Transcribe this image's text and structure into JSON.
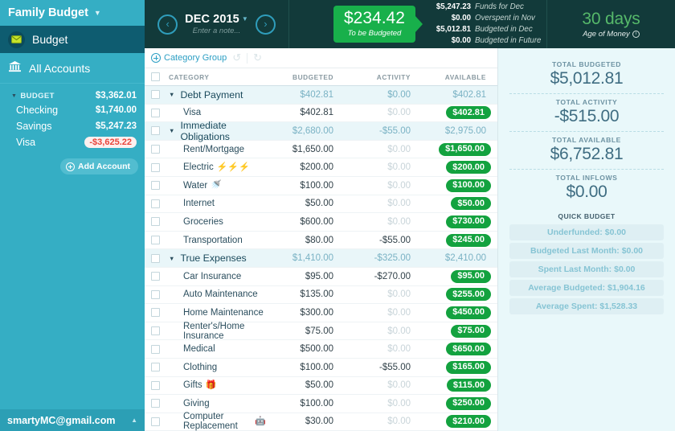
{
  "sidebar": {
    "budget_name": "Family Budget",
    "budget_nav_label": "Budget",
    "accounts_nav_label": "All Accounts",
    "group_label": "BUDGET",
    "group_total": "$3,362.01",
    "accounts": [
      {
        "name": "Checking",
        "balance": "$1,740.00",
        "negative": false
      },
      {
        "name": "Savings",
        "balance": "$5,247.23",
        "negative": false
      },
      {
        "name": "Visa",
        "balance": "-$3,625.22",
        "negative": true
      }
    ],
    "add_account_label": "Add Account",
    "user_email": "smartyMC@gmail.com"
  },
  "header": {
    "month": "DEC 2015",
    "note_placeholder": "Enter a note...",
    "prev_label": "‹",
    "next_label": "›",
    "to_be_budgeted_amount": "$234.42",
    "to_be_budgeted_label": "To be Budgeted",
    "breakdown": [
      {
        "amount": "$5,247.23",
        "label": "Funds for Dec"
      },
      {
        "amount": "$0.00",
        "label": "Overspent in Nov"
      },
      {
        "amount": "$5,012.81",
        "label": "Budgeted in Dec"
      },
      {
        "amount": "$0.00",
        "label": "Budgeted in Future"
      }
    ],
    "age_of_money_value": "30 days",
    "age_of_money_label": "Age of Money"
  },
  "toolbar": {
    "category_group_label": "Category Group",
    "undo_icon": "undo-icon",
    "redo_icon": "redo-icon"
  },
  "table": {
    "columns": {
      "category": "CATEGORY",
      "budgeted": "BUDGETED",
      "activity": "ACTIVITY",
      "available": "AVAILABLE"
    },
    "rows": [
      {
        "type": "group",
        "name": "Debt Payment",
        "budgeted": "$402.81",
        "activity": "$0.00",
        "available": "$402.81",
        "emoji": ""
      },
      {
        "type": "item",
        "name": "Visa",
        "budgeted": "$402.81",
        "activity": "$0.00",
        "activity_zero": true,
        "available": "$402.81",
        "emoji": ""
      },
      {
        "type": "group",
        "name": "Immediate Obligations",
        "budgeted": "$2,680.00",
        "activity": "-$55.00",
        "available": "$2,975.00",
        "emoji": ""
      },
      {
        "type": "item",
        "name": "Rent/Mortgage",
        "budgeted": "$1,650.00",
        "activity": "$0.00",
        "activity_zero": true,
        "available": "$1,650.00",
        "emoji": ""
      },
      {
        "type": "item",
        "name": "Electric",
        "budgeted": "$200.00",
        "activity": "$0.00",
        "activity_zero": true,
        "available": "$200.00",
        "emoji": "⚡⚡⚡"
      },
      {
        "type": "item",
        "name": "Water",
        "budgeted": "$100.00",
        "activity": "$0.00",
        "activity_zero": true,
        "available": "$100.00",
        "emoji": "🚿"
      },
      {
        "type": "item",
        "name": "Internet",
        "budgeted": "$50.00",
        "activity": "$0.00",
        "activity_zero": true,
        "available": "$50.00",
        "emoji": ""
      },
      {
        "type": "item",
        "name": "Groceries",
        "budgeted": "$600.00",
        "activity": "$0.00",
        "activity_zero": true,
        "available": "$730.00",
        "emoji": ""
      },
      {
        "type": "item",
        "name": "Transportation",
        "budgeted": "$80.00",
        "activity": "-$55.00",
        "available": "$245.00",
        "emoji": ""
      },
      {
        "type": "group",
        "name": "True Expenses",
        "budgeted": "$1,410.00",
        "activity": "-$325.00",
        "available": "$2,410.00",
        "emoji": ""
      },
      {
        "type": "item",
        "name": "Car Insurance",
        "budgeted": "$95.00",
        "activity": "-$270.00",
        "available": "$95.00",
        "emoji": ""
      },
      {
        "type": "item",
        "name": "Auto Maintenance",
        "budgeted": "$135.00",
        "activity": "$0.00",
        "activity_zero": true,
        "available": "$255.00",
        "emoji": ""
      },
      {
        "type": "item",
        "name": "Home Maintenance",
        "budgeted": "$300.00",
        "activity": "$0.00",
        "activity_zero": true,
        "available": "$450.00",
        "emoji": ""
      },
      {
        "type": "item",
        "name": "Renter's/Home Insurance",
        "budgeted": "$75.00",
        "activity": "$0.00",
        "activity_zero": true,
        "available": "$75.00",
        "emoji": ""
      },
      {
        "type": "item",
        "name": "Medical",
        "budgeted": "$500.00",
        "activity": "$0.00",
        "activity_zero": true,
        "available": "$650.00",
        "emoji": ""
      },
      {
        "type": "item",
        "name": "Clothing",
        "budgeted": "$100.00",
        "activity": "-$55.00",
        "available": "$165.00",
        "emoji": ""
      },
      {
        "type": "item",
        "name": "Gifts",
        "budgeted": "$50.00",
        "activity": "$0.00",
        "activity_zero": true,
        "available": "$115.00",
        "emoji": "🎁"
      },
      {
        "type": "item",
        "name": "Giving",
        "budgeted": "$100.00",
        "activity": "$0.00",
        "activity_zero": true,
        "available": "$250.00",
        "emoji": ""
      },
      {
        "type": "item",
        "name": "Computer Replacement",
        "budgeted": "$30.00",
        "activity": "$0.00",
        "activity_zero": true,
        "available": "$210.00",
        "emoji": "🤖"
      }
    ]
  },
  "inspector": {
    "totals": [
      {
        "label": "TOTAL BUDGETED",
        "value": "$5,012.81"
      },
      {
        "label": "TOTAL ACTIVITY",
        "value": "-$515.00"
      },
      {
        "label": "TOTAL AVAILABLE",
        "value": "$6,752.81"
      },
      {
        "label": "TOTAL INFLOWS",
        "value": "$0.00"
      }
    ],
    "quick_budget_title": "QUICK BUDGET",
    "quick_budget_buttons": [
      "Underfunded: $0.00",
      "Budgeted Last Month: $0.00",
      "Spent Last Month: $0.00",
      "Average Budgeted: $1,904.16",
      "Average Spent: $1,528.33"
    ]
  },
  "colors": {
    "sidebar_teal": "#35aec4",
    "header_dark": "#123a3a",
    "green_accent": "#18b04b",
    "pill_green": "#13a23f",
    "negative_red": "#e8453c",
    "inspector_bg": "#e9f8fa"
  }
}
